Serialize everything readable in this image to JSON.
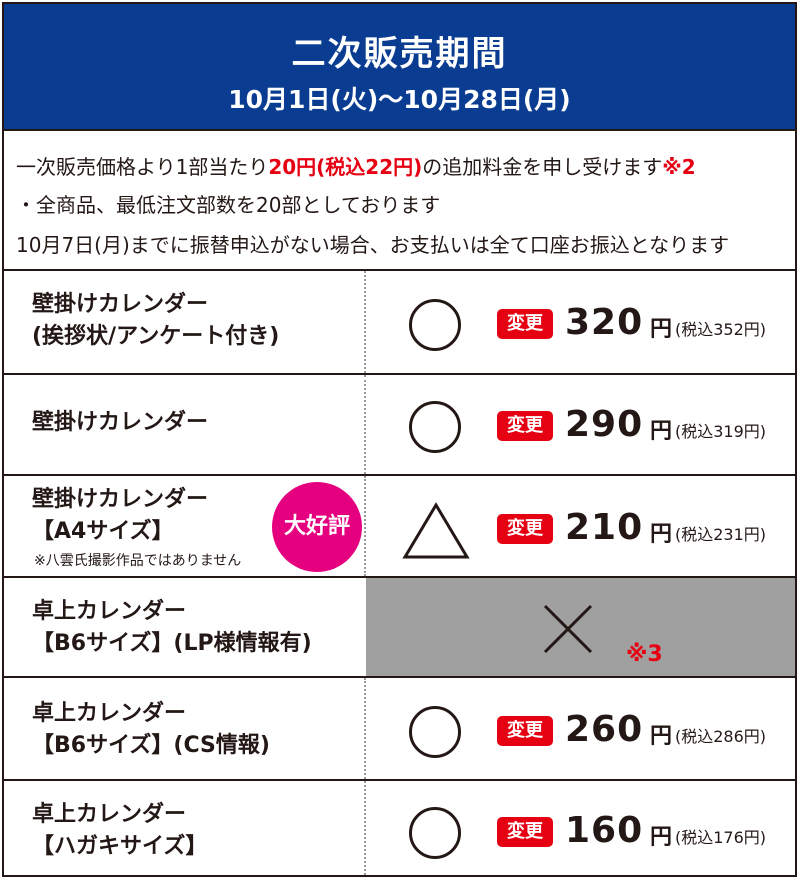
{
  "header": {
    "title": "二次販売期間",
    "dates": "10月1日(火)〜10月28日(月)"
  },
  "notes": {
    "line1_pre": "一次販売価格より1部当たり",
    "line1_red": "20円(税込22円)",
    "line1_mid": "の追加料金を申し受けます",
    "line1_ref": "※2",
    "line2": "・全商品、最低注文部数を20部としております",
    "line3": "10月7日(月)までに振替申込がない場合、お支払いは全て口座お振込となります"
  },
  "colors": {
    "header_bg": "#0a3d91",
    "accent_red": "#e50012",
    "badge_pink": "#e4007f",
    "unavailable_grey": "#a0a0a0"
  },
  "rows": [
    {
      "name_line1": "壁掛けカレンダー",
      "name_line2": "(挨拶状/アンケート付き)",
      "mark": "○",
      "mark_icon": "circle-icon",
      "change": "変更",
      "price": "320",
      "yen": "円",
      "tax": "(税込352円)"
    },
    {
      "name_line1": "壁掛けカレンダー",
      "mark": "○",
      "mark_icon": "circle-icon",
      "change": "変更",
      "price": "290",
      "yen": "円",
      "tax": "(税込319円)"
    },
    {
      "name_line1": "壁掛けカレンダー",
      "name_line2": "【A4サイズ】",
      "subnote": "※八雲氏撮影作品ではありません",
      "badge": "大好評",
      "mark": "△",
      "mark_icon": "triangle-icon",
      "change": "変更",
      "price": "210",
      "yen": "円",
      "tax": "(税込231円)"
    },
    {
      "name_line1": "卓上カレンダー",
      "name_line2": "【B6サイズ】(LP様情報有)",
      "mark": "×",
      "mark_icon": "cross-icon",
      "note": "※3"
    },
    {
      "name_line1": "卓上カレンダー",
      "name_line2": "【B6サイズ】(CS情報)",
      "mark": "○",
      "mark_icon": "circle-icon",
      "change": "変更",
      "price": "260",
      "yen": "円",
      "tax": "(税込286円)"
    },
    {
      "name_line1": "卓上カレンダー",
      "name_line2": "【ハガキサイズ】",
      "mark": "○",
      "mark_icon": "circle-icon",
      "change": "変更",
      "price": "160",
      "yen": "円",
      "tax": "(税込176円)"
    }
  ]
}
